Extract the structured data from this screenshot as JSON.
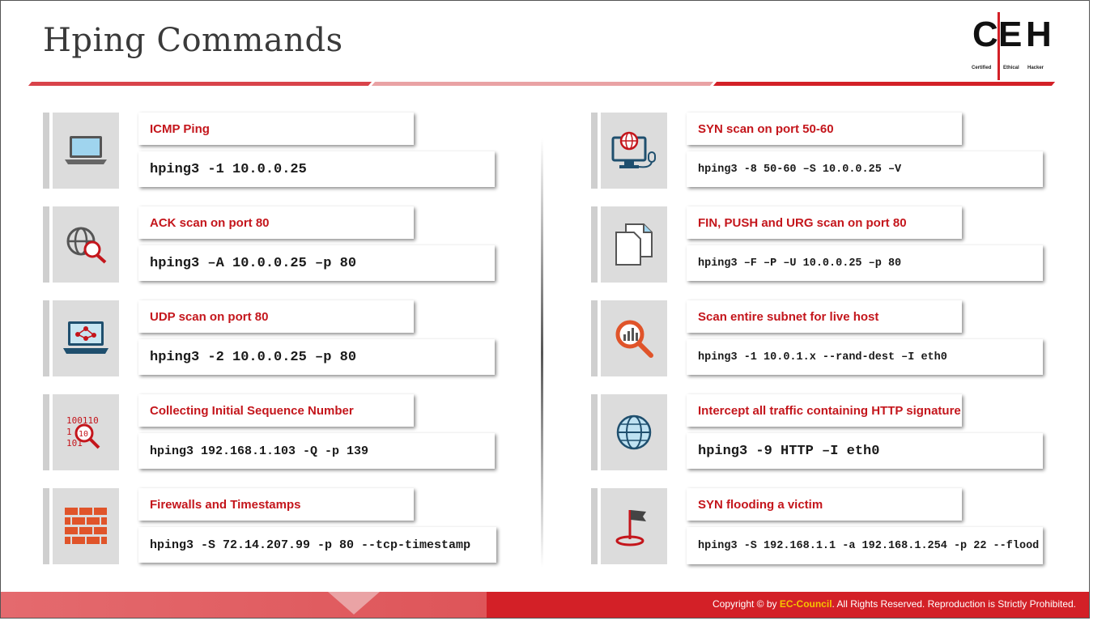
{
  "title": "Hping Commands",
  "logo": {
    "letters": [
      "C",
      "E",
      "H"
    ],
    "tagline": [
      "Certified",
      "Ethical",
      "Hacker"
    ]
  },
  "cards": [
    {
      "label": "ICMP Ping",
      "command": "hping3 -1 10.0.0.25",
      "icon": "laptop-icon"
    },
    {
      "label": "ACK scan on port 80",
      "command": "hping3 –A 10.0.0.25 –p 80",
      "icon": "globe-search-icon"
    },
    {
      "label": "UDP scan on port 80",
      "command": "hping3 -2 10.0.0.25 –p 80",
      "icon": "network-laptop-icon"
    },
    {
      "label": "Collecting Initial Sequence Number",
      "command": "hping3 192.168.1.103 -Q -p 139",
      "icon": "binary-search-icon"
    },
    {
      "label": "Firewalls and Timestamps",
      "command": "hping3 -S 72.14.207.99 -p 80 --tcp-timestamp",
      "icon": "firewall-icon"
    },
    {
      "label": "SYN scan on port 50-60",
      "command": "hping3 -8 50-60 –S 10.0.0.25 –V",
      "icon": "web-monitor-icon"
    },
    {
      "label": "FIN, PUSH and URG scan on port 80",
      "command": "hping3 –F –P –U 10.0.0.25 –p 80",
      "icon": "documents-icon"
    },
    {
      "label": "Scan entire subnet for live host",
      "command": "hping3 -1 10.0.1.x --rand-dest –I eth0",
      "icon": "analytics-search-icon"
    },
    {
      "label": "Intercept all traffic containing HTTP signature",
      "command": "hping3 -9 HTTP –I eth0",
      "icon": "globe-icon"
    },
    {
      "label": "SYN flooding a victim",
      "command": "hping3 -S 192.168.1.1 -a 192.168.1.254 -p 22 --flood",
      "icon": "flag-target-icon"
    }
  ],
  "footer": {
    "prefix": "Copyright © by ",
    "brand": "EC-Council",
    "suffix": ". All Rights Reserved. Reproduction is Strictly Prohibited."
  },
  "colors": {
    "accent": "#d32027",
    "label_text": "#c4161c",
    "icon_box": "#dcdcdc"
  }
}
